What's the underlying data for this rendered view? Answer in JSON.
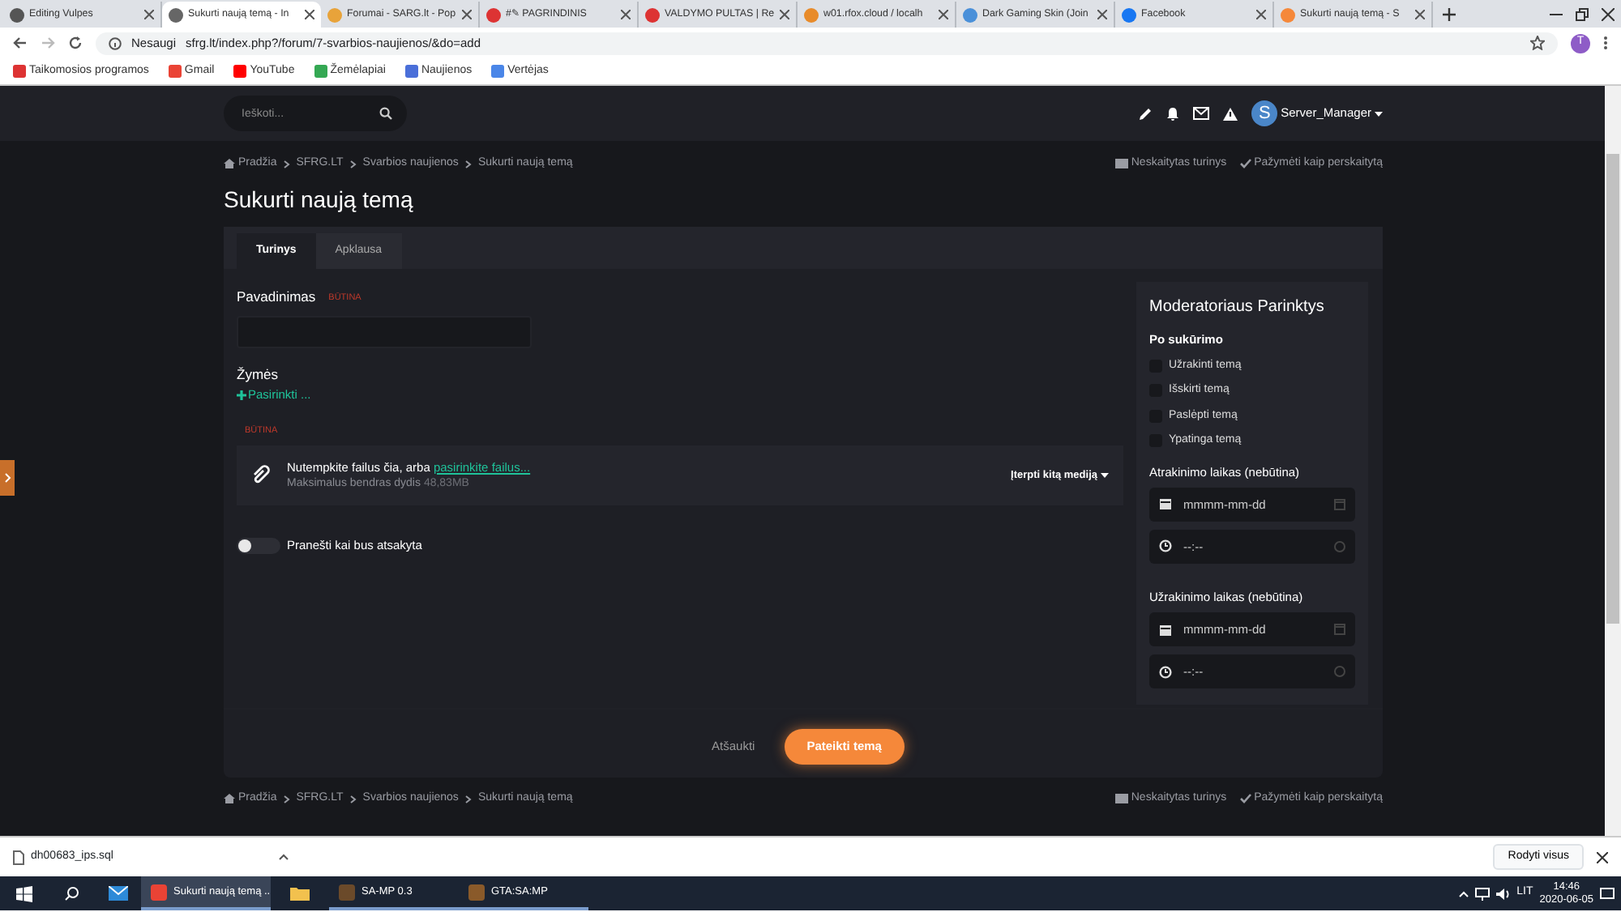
{
  "browser": {
    "tabs": [
      {
        "label": "Editing Vulpes",
        "selected": false
      },
      {
        "label": "Sukurti naują temą - In",
        "selected": true
      },
      {
        "label": "Forumai - SARG.lt - Pop",
        "selected": false
      },
      {
        "label": "#✎ PAGRINDINIS",
        "selected": false
      },
      {
        "label": "VALDYMO PULTAS | Re",
        "selected": false
      },
      {
        "label": "w01.rfox.cloud / localh",
        "selected": false
      },
      {
        "label": "Dark Gaming Skin (Join",
        "selected": false
      },
      {
        "label": "Facebook",
        "selected": false
      },
      {
        "label": "Sukurti naują temą - S",
        "selected": false
      }
    ],
    "security": "Nesaugi",
    "url": "sfrg.lt/index.php?/forum/7-svarbios-naujienos/&do=add",
    "profile": "T",
    "bookmarks": [
      "Taikomosios programos",
      "Gmail",
      "YouTube",
      "Žemėlapiai",
      "Naujienos",
      "Vertėjas"
    ]
  },
  "header": {
    "search_placeholder": "Ieškoti...",
    "avatar": "S",
    "user": "Server_Manager"
  },
  "breadcrumb_top": {
    "items": [
      "Pradžia",
      "SFRG.LT",
      "Svarbios naujienos",
      "Sukurti naują temą"
    ],
    "unread": "Neskaitytas turinys",
    "mark_read": "Pažymėti kaip perskaitytą"
  },
  "title": "Sukurti naują temą",
  "form_tabs": [
    {
      "label": "Turinys",
      "selected": true
    },
    {
      "label": "Apklausa",
      "selected": false
    }
  ],
  "form": {
    "title_label": "Pavadinimas",
    "required": "BŪTINA",
    "tags_label": "Žymės",
    "tags_add": "Pasirinkti ...",
    "editor_required": "BŪTINA",
    "upload_text": "Nutempkite failus čia, arba ",
    "upload_link": "pasirinkite failus...",
    "upload_limit": "Maksimalus bendras dydis ",
    "upload_size": "48,83MB",
    "insert_media": "Įterpti kitą mediją",
    "notify": {
      "label": "Pranešti kai bus atsakyta",
      "on": false
    }
  },
  "moderator": {
    "title": "Moderatoriaus Parinktys",
    "section": "Po sukūrimo",
    "options": [
      {
        "label": "Užrakinti temą",
        "checked": false
      },
      {
        "label": "Išskirti temą",
        "checked": false
      },
      {
        "label": "Paslėpti temą",
        "checked": false
      },
      {
        "label": "Ypatinga temą",
        "checked": false
      }
    ],
    "times": [
      {
        "label": "Atrakinimo laikas (nebūtina)",
        "date_placeholder": "mmmm-mm-dd",
        "time_placeholder": "--:--"
      },
      {
        "label": "Užrakinimo laikas (nebūtina)",
        "date_placeholder": "mmmm-mm-dd",
        "time_placeholder": "--:--"
      }
    ]
  },
  "actions": {
    "cancel": "Atšaukti",
    "submit": "Pateikti temą"
  },
  "breadcrumb_bottom": {
    "items": [
      "Pradžia",
      "SFRG.LT",
      "Svarbios naujienos",
      "Sukurti naują temą"
    ],
    "unread": "Neskaitytas turinys",
    "mark_read": "Pažymėti kaip perskaitytą"
  },
  "downloads": {
    "file": "dh00683_ips.sql",
    "show_all": "Rodyti visus"
  },
  "taskbar": {
    "apps": [
      {
        "label": "Sukurti naują temą ...",
        "selected": true
      },
      {
        "label": "SA-MP 0.3",
        "selected": false
      },
      {
        "label": "GTA:SA:MP",
        "selected": false
      }
    ],
    "language": "LIT",
    "time": "14:46",
    "date": "2020-06-05"
  }
}
